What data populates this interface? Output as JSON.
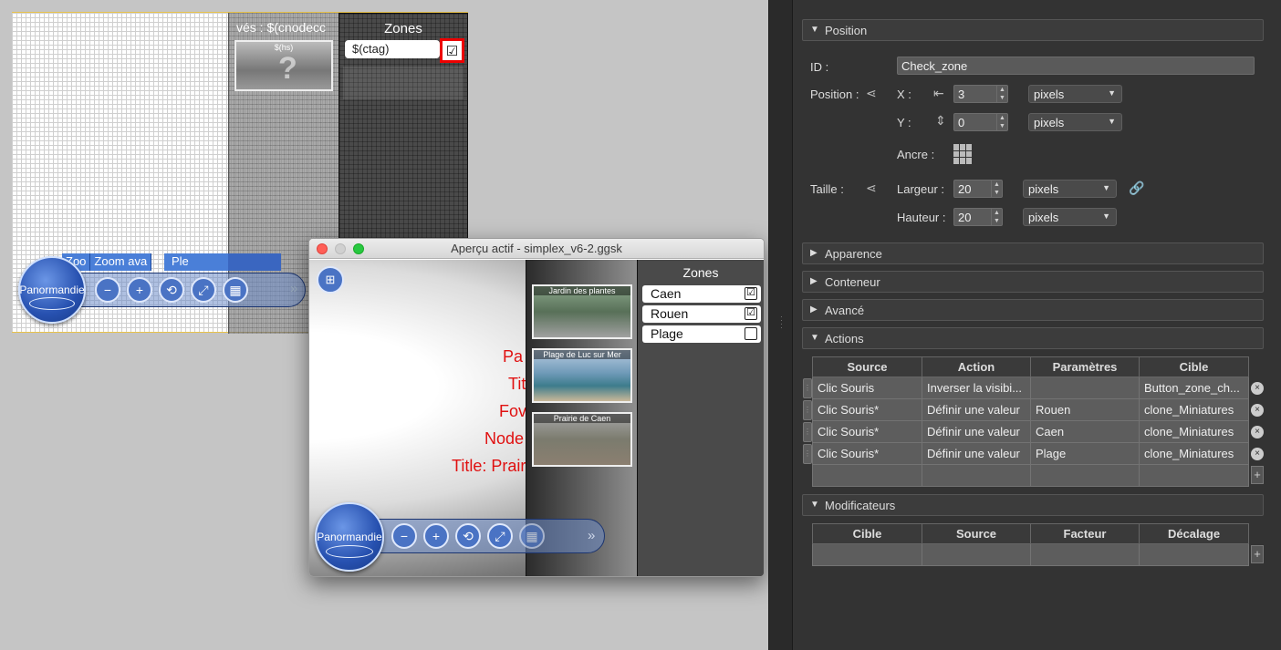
{
  "canvas": {
    "strip_title": "vés : $(cnodecc",
    "hs_label": "$(hs)",
    "zones_title": "Zones",
    "ctag_label": "$(ctag)",
    "check_glyph": "☑",
    "tabs": [
      "Zoo",
      "Zoom ava",
      "Ple"
    ],
    "logo_text": "Panormandie",
    "more_glyph": "»"
  },
  "preview": {
    "title": "Aperçu actif - simplex_v6-2.ggsk",
    "overlay_lines": [
      "Pa",
      "Tit",
      "Fov",
      "Node",
      "Title: Prairie de Caen"
    ],
    "thumbnails": [
      "Jardin des plantes",
      "Plage de Luc sur Mer",
      "Prairie de Caen"
    ],
    "zones_title": "Zones",
    "zones": [
      {
        "label": "Caen",
        "checked": "☑"
      },
      {
        "label": "Rouen",
        "checked": "☑"
      },
      {
        "label": "Plage",
        "checked": ""
      }
    ],
    "logo_text": "Panormandie",
    "more_glyph": "»"
  },
  "props": {
    "sections": {
      "position": "Position",
      "apparence": "Apparence",
      "conteneur": "Conteneur",
      "avance": "Avancé",
      "actions": "Actions",
      "modificateurs": "Modificateurs"
    },
    "id_label": "ID :",
    "id_value": "Check_zone",
    "position_label": "Position :",
    "x_label": "X :",
    "x_value": "3",
    "y_label": "Y :",
    "y_value": "0",
    "unit": "pixels",
    "anchor_label": "Ancre :",
    "size_label": "Taille :",
    "width_label": "Largeur :",
    "width_value": "20",
    "height_label": "Hauteur :",
    "height_value": "20",
    "actions_headers": [
      "Source",
      "Action",
      "Paramètres",
      "Cible"
    ],
    "actions_rows": [
      [
        "Clic Souris",
        "Inverser la visibi...",
        "",
        "Button_zone_ch..."
      ],
      [
        "Clic Souris*",
        "Définir une valeur",
        "Rouen",
        "clone_Miniatures"
      ],
      [
        "Clic Souris*",
        "Définir une valeur",
        "Caen",
        "clone_Miniatures"
      ],
      [
        "Clic Souris*",
        "Définir une valeur",
        "Plage",
        "clone_Miniatures"
      ]
    ],
    "mod_headers": [
      "Cible",
      "Source",
      "Facteur",
      "Décalage"
    ]
  }
}
